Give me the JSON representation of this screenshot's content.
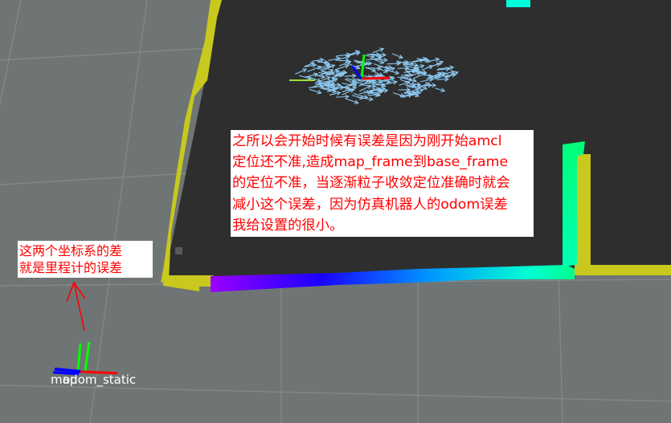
{
  "colors": {
    "background": "#6f7575",
    "grid_line": "#858b8b",
    "map_free_space": "#2e2e2e",
    "map_border": "#c8c81e",
    "particle_arrow": "#8cc8f0",
    "annotation_text": "#ff0000",
    "annotation_bg": "#ffffff",
    "axis_x": "#ff0000",
    "axis_y": "#00ff00",
    "axis_z": "#0000ff",
    "frame_label": "#ffffff",
    "path_gradient": [
      "#9b00ff",
      "#1a00ff",
      "#0096ff",
      "#00ffd2",
      "#00ff8c"
    ]
  },
  "annotations": {
    "main": {
      "lines": [
        "之所以会开始时候有误差是因为刚开始amcl",
        "定位还不准,造成map_frame到base_frame",
        "的定位不准，当逐渐粒子收敛定位准确时就会",
        "减小这个误差，因为仿真机器人的odom误差",
        "我给设置的很小。"
      ]
    },
    "side": {
      "lines": [
        "这两个坐标系的差",
        "就是里程计的误差"
      ]
    }
  },
  "frames": {
    "label_a": "map",
    "label_b": "odom_static"
  },
  "icons": {
    "particle": "arrow-icon",
    "frame_axes": "tf-axes-icon"
  }
}
